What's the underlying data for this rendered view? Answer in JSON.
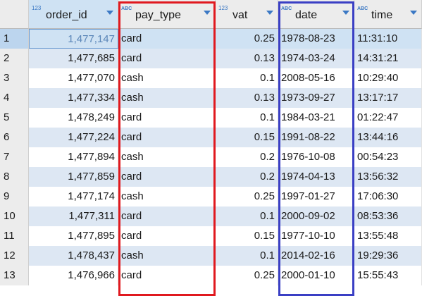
{
  "columns": [
    {
      "key": "order_id",
      "label": "order_id",
      "type_icon": "123"
    },
    {
      "key": "pay_type",
      "label": "pay_type",
      "type_icon": "ABC"
    },
    {
      "key": "vat",
      "label": "vat",
      "type_icon": "123"
    },
    {
      "key": "date",
      "label": "date",
      "type_icon": "ABC"
    },
    {
      "key": "time",
      "label": "time",
      "type_icon": "ABC"
    }
  ],
  "rows": [
    {
      "n": "1",
      "order_id": "1,477,147",
      "pay_type": "card",
      "vat": "0.25",
      "date": "1978-08-23",
      "time": "11:31:10"
    },
    {
      "n": "2",
      "order_id": "1,477,685",
      "pay_type": "card",
      "vat": "0.13",
      "date": "1974-03-24",
      "time": "14:31:21"
    },
    {
      "n": "3",
      "order_id": "1,477,070",
      "pay_type": "cash",
      "vat": "0.1",
      "date": "2008-05-16",
      "time": "10:29:40"
    },
    {
      "n": "4",
      "order_id": "1,477,334",
      "pay_type": "cash",
      "vat": "0.13",
      "date": "1973-09-27",
      "time": "13:17:17"
    },
    {
      "n": "5",
      "order_id": "1,478,249",
      "pay_type": "card",
      "vat": "0.1",
      "date": "1984-03-21",
      "time": "01:22:47"
    },
    {
      "n": "6",
      "order_id": "1,477,224",
      "pay_type": "card",
      "vat": "0.15",
      "date": "1991-08-22",
      "time": "13:44:16"
    },
    {
      "n": "7",
      "order_id": "1,477,894",
      "pay_type": "cash",
      "vat": "0.2",
      "date": "1976-10-08",
      "time": "00:54:23"
    },
    {
      "n": "8",
      "order_id": "1,477,859",
      "pay_type": "card",
      "vat": "0.2",
      "date": "1974-04-13",
      "time": "13:56:32"
    },
    {
      "n": "9",
      "order_id": "1,477,174",
      "pay_type": "cash",
      "vat": "0.25",
      "date": "1997-01-27",
      "time": "17:06:30"
    },
    {
      "n": "10",
      "order_id": "1,477,311",
      "pay_type": "card",
      "vat": "0.1",
      "date": "2000-09-02",
      "time": "08:53:36"
    },
    {
      "n": "11",
      "order_id": "1,477,895",
      "pay_type": "card",
      "vat": "0.15",
      "date": "1977-10-10",
      "time": "13:55:48"
    },
    {
      "n": "12",
      "order_id": "1,478,437",
      "pay_type": "cash",
      "vat": "0.1",
      "date": "2014-02-16",
      "time": "19:29:36"
    },
    {
      "n": "13",
      "order_id": "1,476,966",
      "pay_type": "card",
      "vat": "0.25",
      "date": "2000-01-10",
      "time": "15:55:43"
    }
  ],
  "selected_row": 1,
  "highlights": [
    {
      "column": "pay_type",
      "color": "#e0191f"
    },
    {
      "column": "date",
      "color": "#3a3fc4"
    }
  ],
  "colors": {
    "type_icon": "#3b78c4",
    "row_alt": "#dde7f3",
    "selection": "#cfe2f3"
  }
}
